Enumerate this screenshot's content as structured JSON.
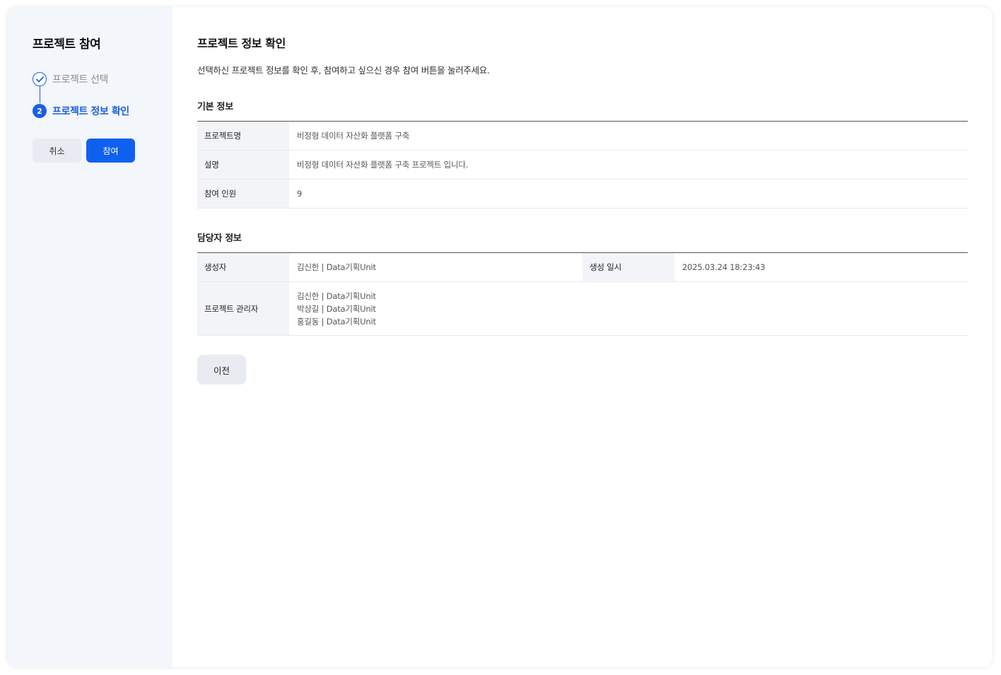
{
  "sidebar": {
    "title": "프로젝트 참여",
    "steps": [
      {
        "label": "프로젝트 선택",
        "state": "done",
        "icon": "check-icon"
      },
      {
        "label": "프로젝트 정보 확인",
        "state": "active",
        "number": "2"
      }
    ],
    "buttons": {
      "cancel": "취소",
      "join": "참여"
    }
  },
  "main": {
    "title": "프로젝트 정보 확인",
    "description": "선택하신 프로젝트 정보를 확인 후, 참여하고 싶으신 경우 참여 버튼을 눌러주세요.",
    "basic_info": {
      "heading": "기본 정보",
      "rows": [
        {
          "label": "프로젝트명",
          "value": "비정형 데이터 자산화 플랫폼 구축"
        },
        {
          "label": "설명",
          "value": "비정형 데이터 자산화 플랫폼 구축 프로젝트 입니다."
        },
        {
          "label": "참여 인원",
          "value": "9"
        }
      ]
    },
    "manager_info": {
      "heading": "담당자 정보",
      "creator_label": "생성자",
      "creator_value": "김신한 | Data기획Unit",
      "created_at_label": "생성 일시",
      "created_at_value": "2025.03.24 18:23:43",
      "admins_label": "프로젝트 관리자",
      "admins": [
        "김신한 | Data기획Unit",
        "박상길 | Data기획Unit",
        "홍길동 | Data기획Unit"
      ]
    },
    "prev_button": "이전"
  },
  "colors": {
    "accent": "#1060f0",
    "step_blue": "#1a5fe0",
    "sidebar_bg": "#f3f6fa",
    "header_cell_bg": "#f2f4f8",
    "secondary_button_bg": "#e8ecf2"
  }
}
